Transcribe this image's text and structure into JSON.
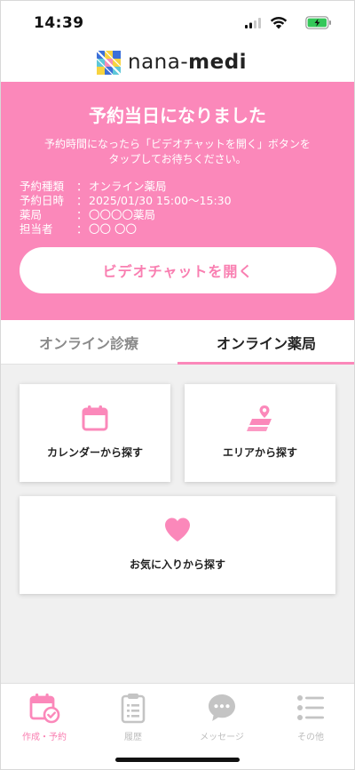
{
  "status_bar": {
    "time": "14:39"
  },
  "header": {
    "logo_text_light": "nana-",
    "logo_text_bold": "medi"
  },
  "banner": {
    "title": "予約当日になりました",
    "description_line1": "予約時間になったら「ビデオチャットを開く」ボタンを",
    "description_line2": "タップしてお待ちください。",
    "details": [
      {
        "label": "予約種類",
        "sep": "：",
        "value": "オンライン薬局"
      },
      {
        "label": "予約日時",
        "sep": "：",
        "value": "2025/01/30  15:00～15:30"
      },
      {
        "label": "薬局",
        "sep": "：",
        "value": "〇〇〇〇薬局"
      },
      {
        "label": "担当者",
        "sep": "：",
        "value": "〇〇 〇〇"
      }
    ],
    "button_label": "ビデオチャットを開く"
  },
  "tabs": [
    {
      "label": "オンライン診療",
      "active": false
    },
    {
      "label": "オンライン薬局",
      "active": true
    }
  ],
  "cards": {
    "calendar": {
      "label": "カレンダーから探す",
      "icon": "calendar-icon"
    },
    "area": {
      "label": "エリアから探す",
      "icon": "map-pin-icon"
    },
    "favorite": {
      "label": "お気に入りから探す",
      "icon": "heart-icon"
    }
  },
  "bottom_nav": [
    {
      "label": "作成・予約",
      "icon": "calendar-check-icon",
      "active": true
    },
    {
      "label": "履歴",
      "icon": "clipboard-icon",
      "active": false
    },
    {
      "label": "メッセージ",
      "icon": "chat-bubble-icon",
      "active": false
    },
    {
      "label": "その他",
      "icon": "list-icon",
      "active": false
    }
  ],
  "colors": {
    "accent": "#fb88ba",
    "accent_text": "#f97fb1",
    "inactive": "#bdbdbd"
  }
}
